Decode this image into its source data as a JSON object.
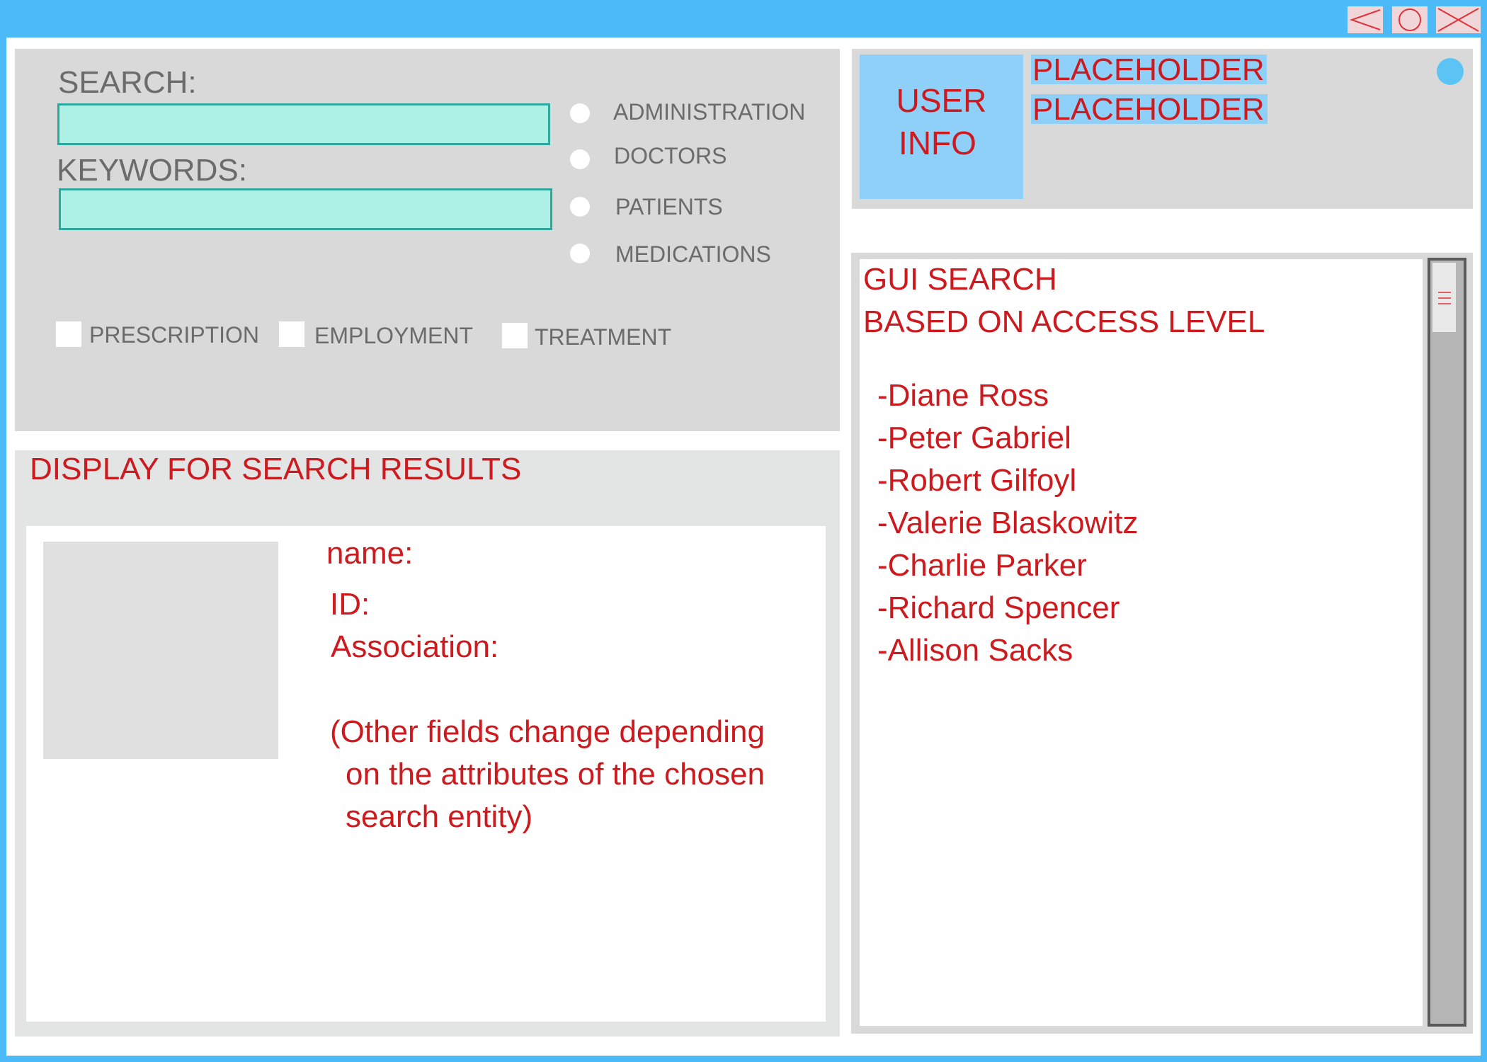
{
  "filters": {
    "search_label": "SEARCH:",
    "search_value": "",
    "keywords_label": "KEYWORDS:",
    "keywords_value": "",
    "categories": [
      "ADMINISTRATION",
      "DOCTORS",
      "PATIENTS",
      "MEDICATIONS"
    ],
    "checkboxes": [
      "PRESCRIPTION",
      "EMPLOYMENT",
      "TREATMENT"
    ]
  },
  "user_info": {
    "box_line1": "USER",
    "box_line2": "INFO",
    "placeholder_1": "PLACEHOLDER",
    "placeholder_2": "PLACEHOLDER",
    "status_dot_color": "#5bc4f5"
  },
  "results": {
    "title": "DISPLAY FOR SEARCH RESULTS",
    "name_label": "name:",
    "id_label": "ID:",
    "association_label": "Association:",
    "note_line1": "(Other fields change depending",
    "note_line2": "on the attributes of the chosen",
    "note_line3": "search entity)"
  },
  "search_list": {
    "title_line1": "GUI SEARCH",
    "title_line2": "BASED ON ACCESS LEVEL",
    "items": [
      "-Diane Ross",
      "-Peter Gabriel",
      "-Robert Gilfoyl",
      "-Valerie Blaskowitz",
      "-Charlie Parker",
      "-Richard Spencer",
      "-Allison Sacks"
    ]
  },
  "colors": {
    "accent": "#4cbaf7",
    "text_red": "#cc1a1e",
    "input_fill": "#adf0e6",
    "panel_grey": "#d9d9d9",
    "user_info_box": "#8fd0f8"
  }
}
